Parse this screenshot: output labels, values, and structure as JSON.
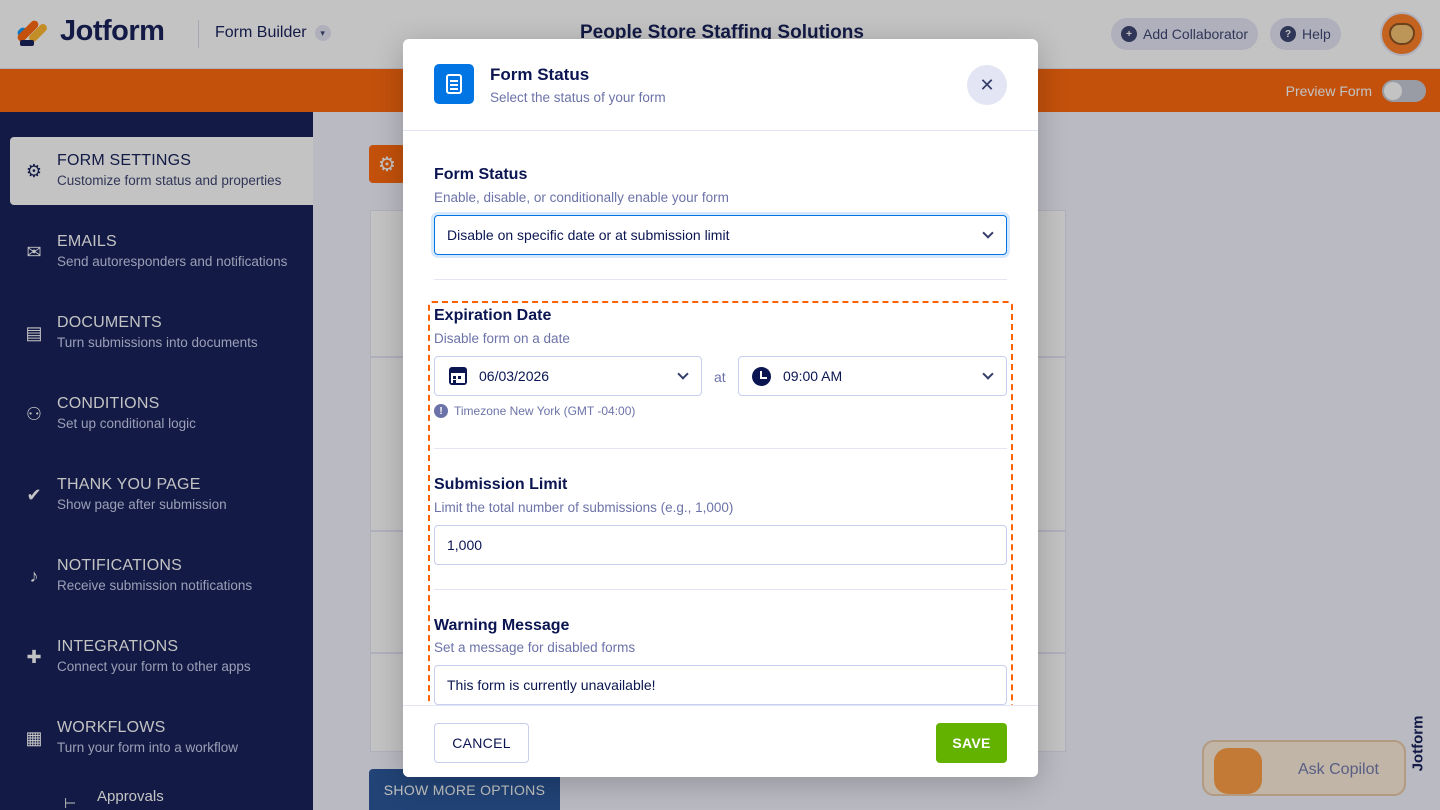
{
  "header": {
    "logo_text": "Jotform",
    "form_builder_label": "Form Builder",
    "form_title": "People Store Staffing Solutions",
    "add_collaborator_label": "Add Collaborator",
    "help_label": "Help"
  },
  "subbar": {
    "preview_label": "Preview Form"
  },
  "sidebar": {
    "items": [
      {
        "title": "FORM SETTINGS",
        "subtitle": "Customize form status and properties",
        "icon": "gear-icon"
      },
      {
        "title": "EMAILS",
        "subtitle": "Send autoresponders and notifications",
        "icon": "envelope-icon"
      },
      {
        "title": "DOCUMENTS",
        "subtitle": "Turn submissions into documents",
        "icon": "document-icon"
      },
      {
        "title": "CONDITIONS",
        "subtitle": "Set up conditional logic",
        "icon": "sitemap-icon"
      },
      {
        "title": "THANK YOU PAGE",
        "subtitle": "Show page after submission",
        "icon": "check-circle-icon"
      },
      {
        "title": "NOTIFICATIONS",
        "subtitle": "Receive submission notifications",
        "icon": "bell-icon"
      },
      {
        "title": "INTEGRATIONS",
        "subtitle": "Connect your form to other apps",
        "icon": "puzzle-icon"
      },
      {
        "title": "WORKFLOWS",
        "subtitle": "Turn your form into a workflow",
        "icon": "workflow-icon"
      }
    ],
    "sub_item": "Approvals"
  },
  "main": {
    "show_more_label": "SHOW MORE OPTIONS",
    "copilot_label": "Ask Copilot",
    "side_brand": "Jotform"
  },
  "modal": {
    "title": "Form Status",
    "subtitle": "Select the status of your form",
    "close_symbol": "✕",
    "status": {
      "title": "Form Status",
      "subtitle": "Enable, disable, or conditionally enable your form",
      "selected": "Disable on specific date or at submission limit"
    },
    "expiration": {
      "title": "Expiration Date",
      "subtitle": "Disable form on a date",
      "date": "06/03/2026",
      "at_label": "at",
      "time": "09:00 AM",
      "timezone": "Timezone New York (GMT -04:00)"
    },
    "limit": {
      "title": "Submission Limit",
      "subtitle": "Limit the total number of submissions (e.g., 1,000)",
      "value": "1,000"
    },
    "warning": {
      "title": "Warning Message",
      "subtitle": "Set a message for disabled forms",
      "value": "This form is currently unavailable!"
    },
    "cancel_label": "CANCEL",
    "save_label": "SAVE"
  },
  "colors": {
    "brand_navy": "#0a1551",
    "accent_orange": "#ff6100",
    "save_green": "#64b200",
    "focus_blue": "#0075e3"
  }
}
